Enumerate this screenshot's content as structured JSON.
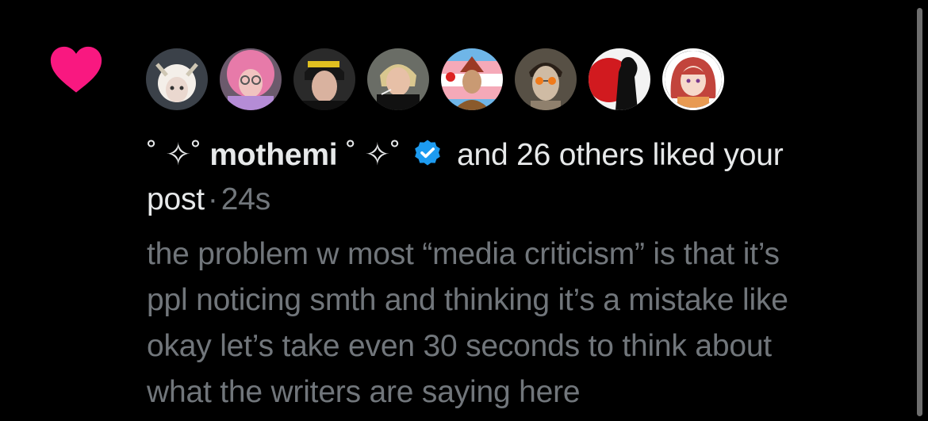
{
  "notification": {
    "icon": "heart-icon",
    "icon_color": "#f91880",
    "avatars": [
      {
        "name": "avatar-1",
        "bg": "#3b4149",
        "skin": "#ead8cf",
        "hair": "#f4efe9"
      },
      {
        "name": "avatar-2",
        "bg": "#6b5a6c",
        "skin": "#f0c3c0",
        "hair": "#e77aa9"
      },
      {
        "name": "avatar-3",
        "bg": "#2a2a2a",
        "skin": "#d9b29f",
        "hair": "#161616"
      },
      {
        "name": "avatar-4",
        "bg": "#6a6d66",
        "skin": "#e7c0a7",
        "hair": "#d9c78f"
      },
      {
        "name": "avatar-5",
        "bg": "#6fb6e8",
        "skin": "#c99a73",
        "hair": "#9b3a26"
      },
      {
        "name": "avatar-6",
        "bg": "#575045",
        "skin": "#cfbba4",
        "hair": "#2a2018"
      },
      {
        "name": "avatar-7",
        "bg": "#d11a1f",
        "skin": "#f3f3f3",
        "hair": "#101010"
      },
      {
        "name": "avatar-8",
        "bg": "#ffffff",
        "skin": "#f6d9cb",
        "hair": "#c2443c"
      }
    ],
    "user_prefix": "˚ ✧˚ ",
    "user_name": "mothemi",
    "user_suffix": " ˚ ✧˚",
    "verified_color": "#1d9bf0",
    "action_text": "and 26 others liked your post",
    "separator": "·",
    "time": "24s"
  },
  "post": {
    "lines": [
      "the problem w most “media criticism” is that it’s",
      "ppl noticing smth and thinking it’s a mistake like",
      "okay let’s take even 30 seconds to think about",
      "what the writers are saying here"
    ]
  }
}
